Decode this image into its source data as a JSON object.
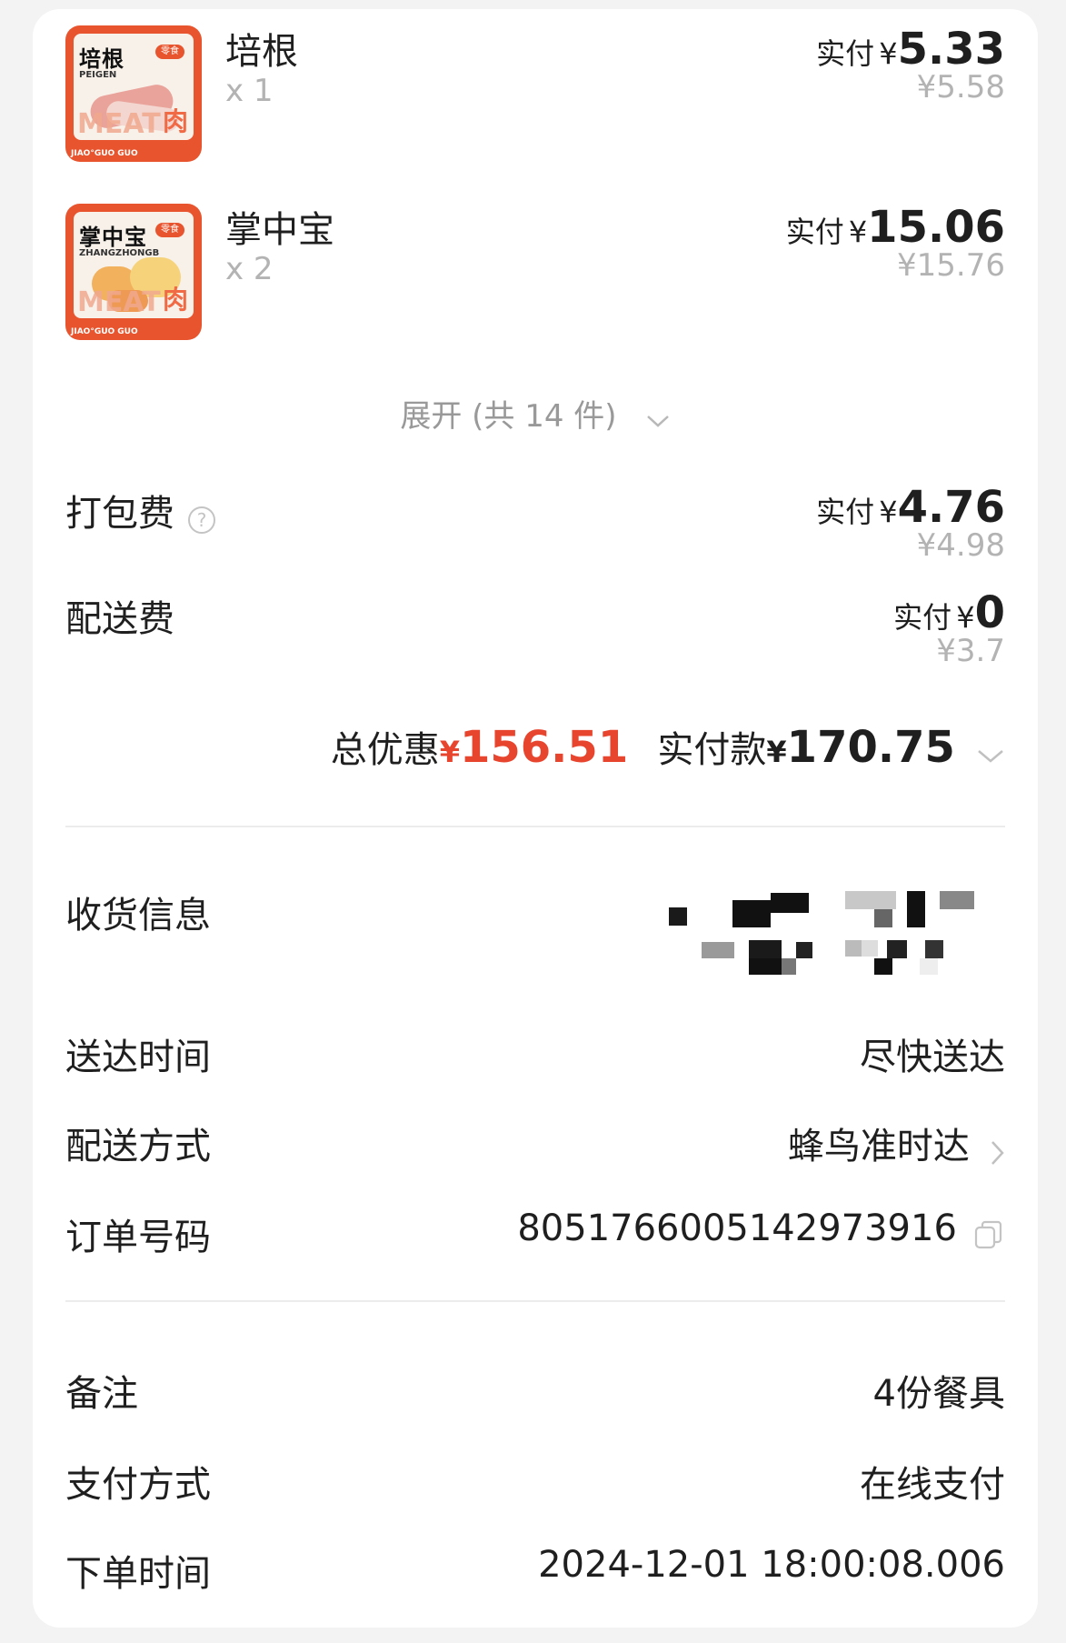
{
  "items": [
    {
      "name": "培根",
      "qty": "x 1",
      "thumb_title": "培根",
      "thumb_sub": "PEIGEN",
      "pay_label": "实付",
      "pay_currency": "¥",
      "pay_value": "5.33",
      "orig_price": "¥5.58"
    },
    {
      "name": "掌中宝",
      "qty": "x 2",
      "thumb_title": "掌中宝",
      "thumb_sub": "ZHANGZHONGB",
      "pay_label": "实付",
      "pay_currency": "¥",
      "pay_value": "15.06",
      "orig_price": "¥15.76"
    }
  ],
  "thumb_common": {
    "meat": "MEAT",
    "rou": "肉",
    "foot": "JIAO°GUO GUO",
    "badge": "零食"
  },
  "expand_label": "展开 (共 14 件)",
  "fees": {
    "packing": {
      "label": "打包费",
      "pay_label": "实付",
      "pay_currency": "¥",
      "pay_value": "4.76",
      "orig_price": "¥4.98"
    },
    "delivery": {
      "label": "配送费",
      "pay_label": "实付",
      "pay_currency": "¥",
      "pay_value": "0",
      "orig_price": "¥3.7"
    }
  },
  "summary": {
    "discount_label": "总优惠",
    "discount_currency": "¥",
    "discount_value": "156.51",
    "paid_label": "实付款",
    "paid_currency": "¥",
    "paid_value": "170.75"
  },
  "details": {
    "receiver_label": "收货信息",
    "time_label": "送达时间",
    "time_value": "尽快送达",
    "method_label": "配送方式",
    "method_value": "蜂鸟准时达",
    "order_label": "订单号码",
    "order_value": "8051766005142973916"
  },
  "extra": {
    "note_label": "备注",
    "note_value": "4份餐具",
    "payment_label": "支付方式",
    "payment_value": "在线支付",
    "ordertime_label": "下单时间",
    "ordertime_value": "2024-12-01 18:00:08.006"
  },
  "colors": {
    "accent_red": "#e8452f",
    "thumb_orange": "#e8542d",
    "muted": "#b3b3b3"
  },
  "icons": {
    "help": "question-circle",
    "expand": "chevron-down",
    "summary": "chevron-down",
    "method": "chevron-right",
    "copy": "copy"
  }
}
